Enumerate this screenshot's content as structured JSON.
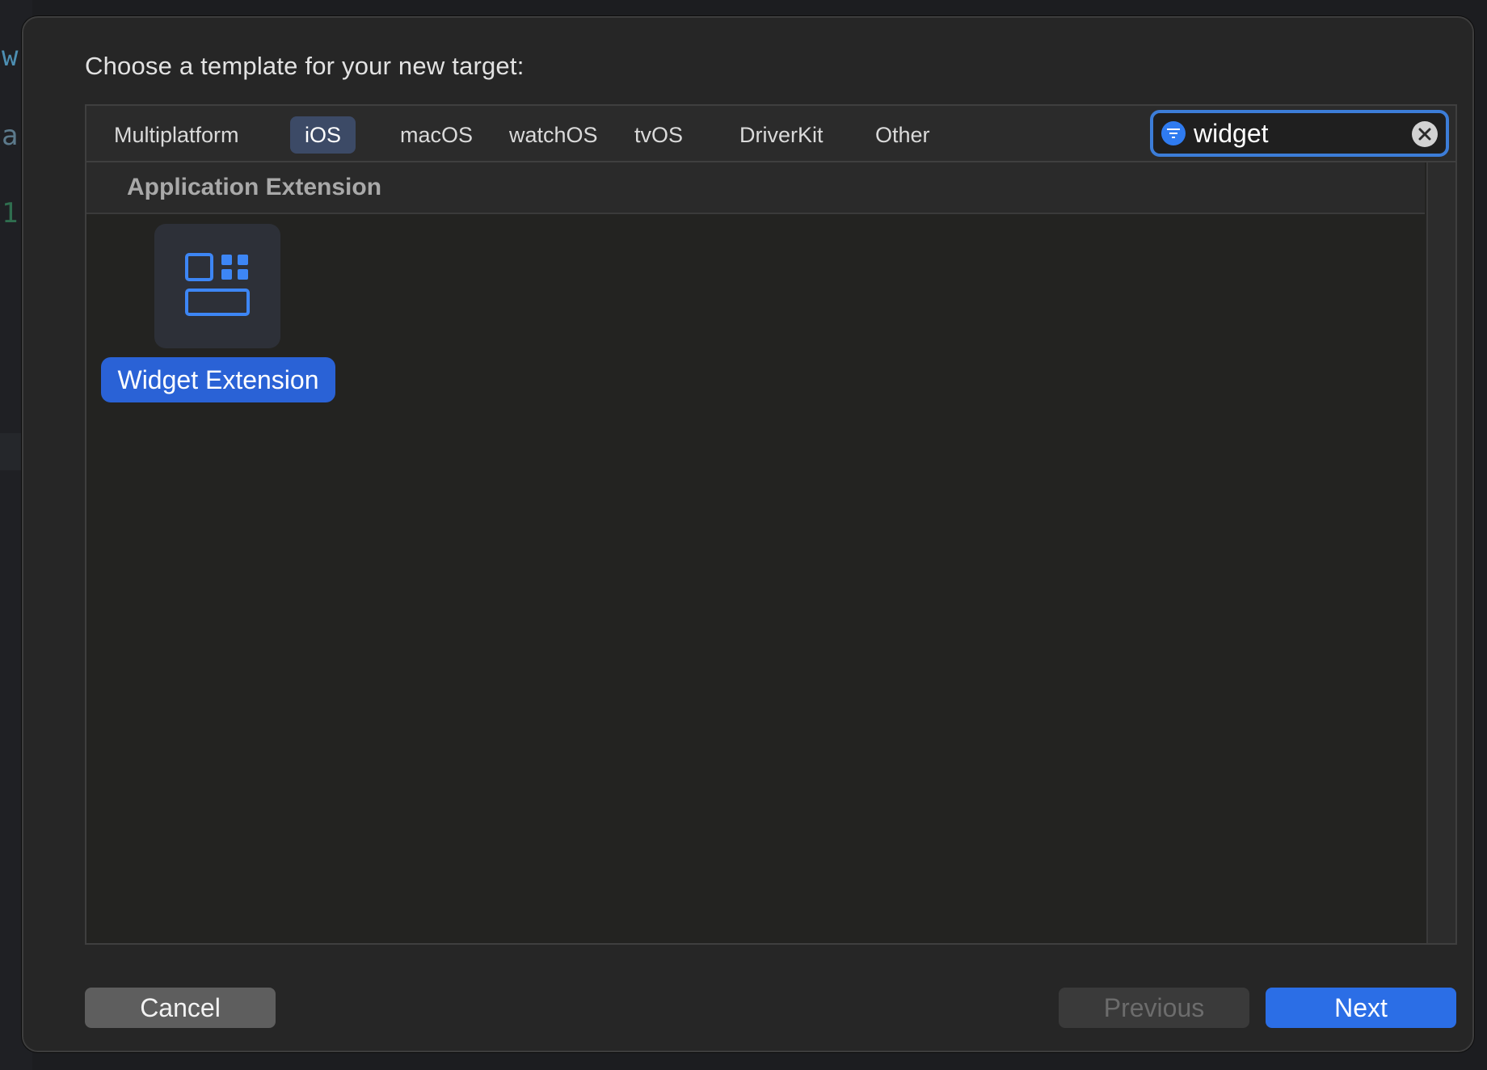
{
  "background_editor": {
    "chars": [
      "w",
      "a",
      "1"
    ]
  },
  "dialog": {
    "title": "Choose a template for your new target:",
    "tabs": [
      {
        "label": "Multiplatform",
        "selected": false
      },
      {
        "label": "iOS",
        "selected": true
      },
      {
        "label": "macOS",
        "selected": false
      },
      {
        "label": "watchOS",
        "selected": false
      },
      {
        "label": "tvOS",
        "selected": false
      },
      {
        "label": "DriverKit",
        "selected": false
      },
      {
        "label": "Other",
        "selected": false
      }
    ],
    "search": {
      "value": "widget",
      "filter_icon": "filter-icon",
      "clear_icon": "clear-icon"
    },
    "section": {
      "title": "Application Extension"
    },
    "templates": [
      {
        "label": "Widget Extension",
        "icon": "widget-extension-icon",
        "selected": true
      }
    ],
    "buttons": {
      "cancel": "Cancel",
      "previous": "Previous",
      "previous_enabled": false,
      "next": "Next"
    }
  },
  "colors": {
    "accent": "#2b6ee6",
    "selected_tab": "#3c4a66",
    "sheet_background": "#262626",
    "panel_background": "#232321"
  }
}
